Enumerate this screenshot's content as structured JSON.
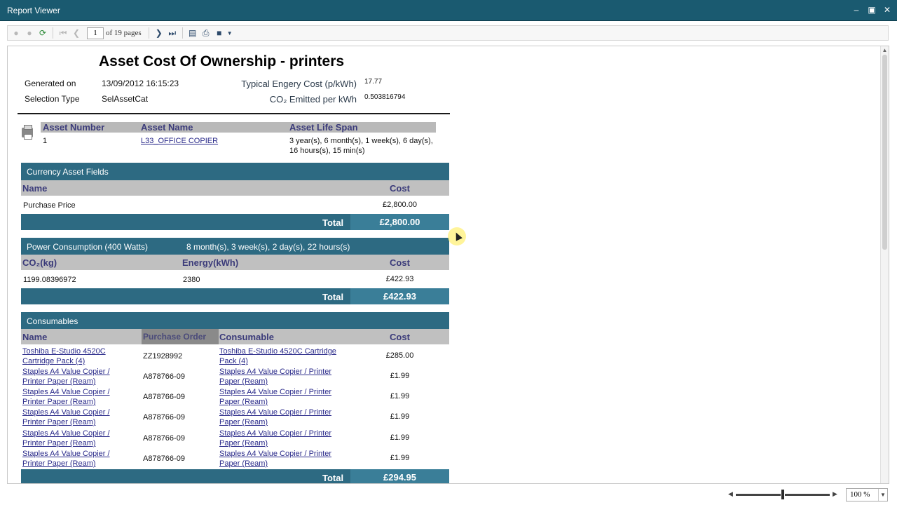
{
  "window": {
    "title": "Report Viewer"
  },
  "toolbar": {
    "page_current": "1",
    "page_label": "of 19 pages",
    "icons": [
      "back-icon",
      "forward-icon",
      "refresh-icon",
      "first-page-icon",
      "prev-page-icon",
      "next-page-icon",
      "last-page-icon",
      "print-layout-icon",
      "print-icon",
      "save-icon",
      "dropdown-icon"
    ]
  },
  "report": {
    "title": "Asset Cost Of Ownership - printers",
    "generated_on_label": "Generated on",
    "generated_on_value": "13/09/2012 16:15:23",
    "selection_type_label": "Selection Type",
    "selection_type_value": "SelAssetCat",
    "energy_cost_label": "Typical Engery Cost (p/kWh)",
    "energy_cost_value": "17.77",
    "co2_label": "CO₂ Emitted per kWh",
    "co2_value": "0.503816794",
    "asset_headers": [
      "Asset Number",
      "Asset Name",
      "Asset Life Span"
    ],
    "asset": {
      "number": "1",
      "name": "L33_OFFICE COPIER",
      "life_span_line1": "3 year(s), 6 month(s), 1 week(s), 6 day(s),",
      "life_span_line2": "16 hours(s), 15 min(s)"
    },
    "currency": {
      "title": "Currency Asset Fields",
      "col_name": "Name",
      "col_cost": "Cost",
      "row_name": "Purchase Price",
      "row_cost": "£2,800.00",
      "total_label": "Total",
      "total_value": "£2,800.00"
    },
    "power": {
      "title": "Power Consumption (400 Watts)",
      "duration": "8 month(s), 3 week(s), 2 day(s), 22 hours(s)",
      "col_co2": "CO₂(kg)",
      "col_energy": "Energy(kWh)",
      "col_cost": "Cost",
      "co2": "1199.08396972",
      "energy": "2380",
      "cost": "£422.93",
      "total_label": "Total",
      "total_value": "£422.93"
    },
    "consumables": {
      "title": "Consumables",
      "col_name": "Name",
      "col_po": "Purchase Order",
      "col_consumable": "Consumable",
      "col_cost": "Cost",
      "rows": [
        {
          "name1": "Toshiba E-Studio 4520C",
          "name2": "Cartridge Pack (4)",
          "po": "ZZ1928992",
          "cons1": "Toshiba E-Studio 4520C Cartridge",
          "cons2": "Pack (4)",
          "cost": "£285.00"
        },
        {
          "name1": "Staples A4 Value Copier /",
          "name2": "Printer Paper (Ream)",
          "po": "A878766-09",
          "cons1": "Staples A4 Value Copier / Printer",
          "cons2": "Paper (Ream)",
          "cost": "£1.99"
        },
        {
          "name1": "Staples A4 Value Copier /",
          "name2": "Printer Paper (Ream)",
          "po": "A878766-09",
          "cons1": "Staples A4 Value Copier / Printer",
          "cons2": "Paper (Ream)",
          "cost": "£1.99"
        },
        {
          "name1": "Staples A4 Value Copier /",
          "name2": "Printer Paper (Ream)",
          "po": "A878766-09",
          "cons1": "Staples A4 Value Copier / Printer",
          "cons2": "Paper (Ream)",
          "cost": "£1.99"
        },
        {
          "name1": "Staples A4 Value Copier /",
          "name2": "Printer Paper (Ream)",
          "po": "A878766-09",
          "cons1": "Staples A4 Value Copier / Printer",
          "cons2": "Paper (Ream)",
          "cost": "£1.99"
        },
        {
          "name1": "Staples A4 Value Copier /",
          "name2": "Printer Paper (Ream)",
          "po": "A878766-09",
          "cons1": "Staples A4 Value Copier / Printer",
          "cons2": "Paper (Ream)",
          "cost": "£1.99"
        }
      ],
      "total_label": "Total",
      "total_value": "£294.95"
    }
  },
  "status": {
    "zoom": "100 %"
  },
  "colors": {
    "titlebar": "#1a5a70",
    "section_bar": "#2d6a82",
    "header_gray": "#b9b9b9",
    "header_text": "#3b3b7a"
  }
}
